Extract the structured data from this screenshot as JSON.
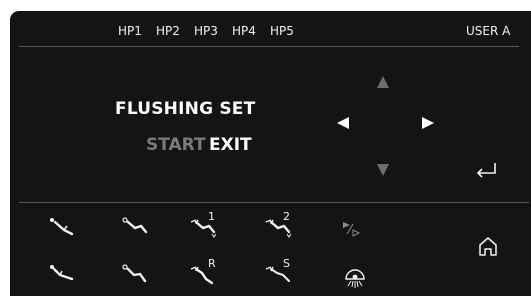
{
  "header": {
    "tabs": [
      {
        "label": "HP1"
      },
      {
        "label": "HP2"
      },
      {
        "label": "HP3"
      },
      {
        "label": "HP4"
      },
      {
        "label": "HP5"
      }
    ],
    "user_label": "USER A"
  },
  "main": {
    "title": "FLUSHING SET",
    "start_label": "START",
    "exit_label": "EXIT"
  },
  "controls": {
    "nav_up_icon": "triangle-up-icon",
    "nav_down_icon": "triangle-down-icon",
    "nav_left_icon": "triangle-left-icon",
    "nav_right_icon": "triangle-right-icon",
    "enter_icon": "enter-return-icon",
    "home_icon": "home-icon"
  },
  "instruments": {
    "row1": [
      {
        "icon": "instrument-1-icon",
        "label": ""
      },
      {
        "icon": "instrument-2-icon",
        "label": ""
      },
      {
        "icon": "instrument-3-icon",
        "label": "1"
      },
      {
        "icon": "instrument-4-icon",
        "label": "2"
      },
      {
        "icon": "play-skip-icon",
        "label": ""
      }
    ],
    "row2": [
      {
        "icon": "instrument-5-icon",
        "label": ""
      },
      {
        "icon": "instrument-6-icon",
        "label": ""
      },
      {
        "icon": "instrument-7-icon",
        "label": "R"
      },
      {
        "icon": "instrument-8-icon",
        "label": "S"
      },
      {
        "icon": "lamp-icon",
        "label": ""
      }
    ]
  },
  "colors": {
    "background": "#141414",
    "text": "#f2f2f2",
    "dim_text": "#7a7a7a",
    "active_arrow": "#ffffff",
    "inactive_arrow": "#6e6e6e"
  }
}
